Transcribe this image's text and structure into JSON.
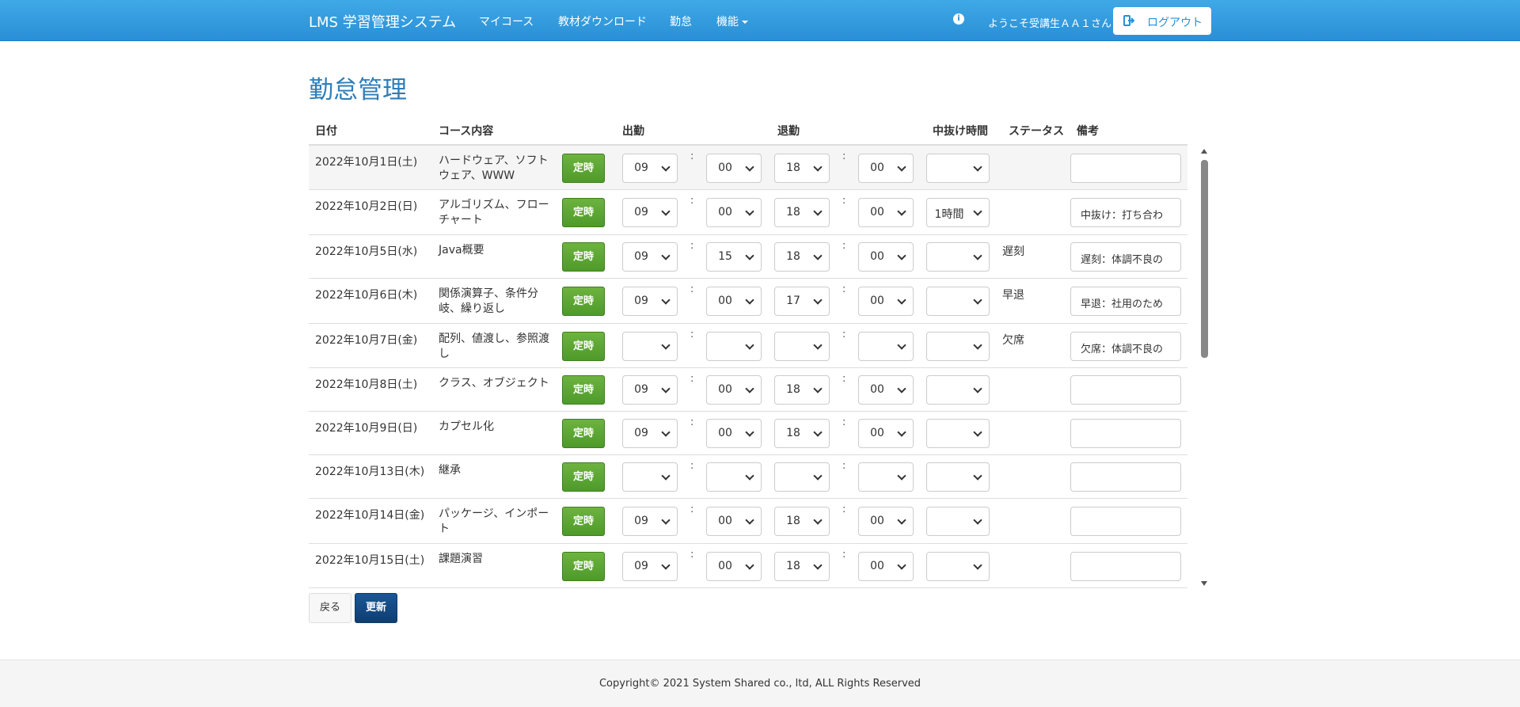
{
  "navbar": {
    "brand": "LMS 学習管理システム",
    "links": [
      "マイコース",
      "教材ダウンロード",
      "勤怠"
    ],
    "menu_label": "機能",
    "info_icon": "i",
    "welcome": "ようこそ受講生ＡＡ１さん",
    "logout_label": "ログアウト",
    "accent_color": "#2a8fd6"
  },
  "page_title": "勤怠管理",
  "table": {
    "headers": {
      "date": "日付",
      "course": "コース内容",
      "start": "出勤",
      "end": "退勤",
      "break": "中抜け時間",
      "status": "ステータス",
      "note": "備考"
    },
    "fixed_button_label": "定時",
    "colon": ":",
    "rows": [
      {
        "date": "2022年10月1日(土)",
        "course": "ハードウェア、ソフトウェア、WWW",
        "start_h": "09",
        "start_m": "00",
        "end_h": "18",
        "end_m": "00",
        "break": "",
        "status": "",
        "note": "",
        "striped": true
      },
      {
        "date": "2022年10月2日(日)",
        "course": "アルゴリズム、フローチャート",
        "start_h": "09",
        "start_m": "00",
        "end_h": "18",
        "end_m": "00",
        "break": "1時間",
        "status": "",
        "note": "中抜け：打ち合わ",
        "striped": false
      },
      {
        "date": "2022年10月5日(水)",
        "course": "Java概要",
        "start_h": "09",
        "start_m": "15",
        "end_h": "18",
        "end_m": "00",
        "break": "",
        "status": "遅刻",
        "note": "遅刻：体調不良の",
        "striped": false
      },
      {
        "date": "2022年10月6日(木)",
        "course": "関係演算子、条件分岐、繰り返し",
        "start_h": "09",
        "start_m": "00",
        "end_h": "17",
        "end_m": "00",
        "break": "",
        "status": "早退",
        "note": "早退：社用のため",
        "striped": false
      },
      {
        "date": "2022年10月7日(金)",
        "course": "配列、値渡し、参照渡し",
        "start_h": "",
        "start_m": "",
        "end_h": "",
        "end_m": "",
        "break": "",
        "status": "欠席",
        "note": "欠席：体調不良の",
        "striped": false
      },
      {
        "date": "2022年10月8日(土)",
        "course": "クラス、オブジェクト",
        "start_h": "09",
        "start_m": "00",
        "end_h": "18",
        "end_m": "00",
        "break": "",
        "status": "",
        "note": "",
        "striped": false
      },
      {
        "date": "2022年10月9日(日)",
        "course": "カプセル化",
        "start_h": "09",
        "start_m": "00",
        "end_h": "18",
        "end_m": "00",
        "break": "",
        "status": "",
        "note": "",
        "striped": false
      },
      {
        "date": "2022年10月13日(木)",
        "course": "継承",
        "start_h": "",
        "start_m": "",
        "end_h": "",
        "end_m": "",
        "break": "",
        "status": "",
        "note": "",
        "striped": false
      },
      {
        "date": "2022年10月14日(金)",
        "course": "パッケージ、インポート",
        "start_h": "09",
        "start_m": "00",
        "end_h": "18",
        "end_m": "00",
        "break": "",
        "status": "",
        "note": "",
        "striped": false
      },
      {
        "date": "2022年10月15日(土)",
        "course": "課題演習",
        "start_h": "09",
        "start_m": "00",
        "end_h": "18",
        "end_m": "00",
        "break": "",
        "status": "",
        "note": "",
        "striped": false
      }
    ]
  },
  "buttons": {
    "back": "戻る",
    "update": "更新"
  },
  "footer": "Copyright© 2021 System Shared co., ltd, ALL Rights Reserved"
}
